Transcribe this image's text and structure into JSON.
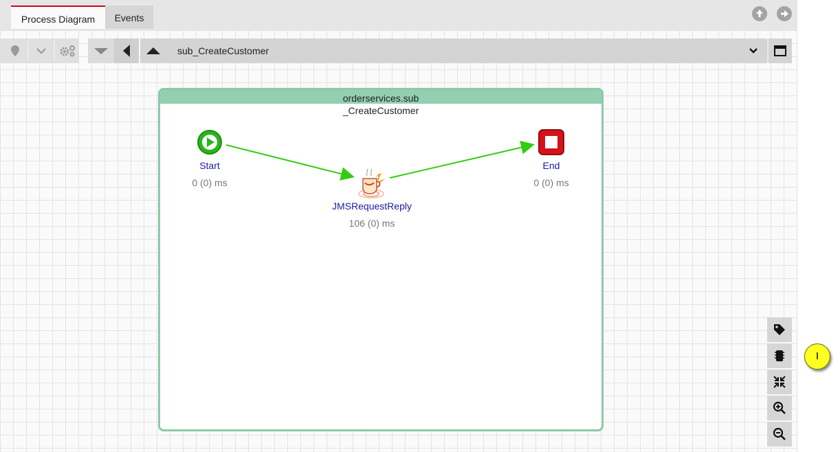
{
  "tabs": [
    {
      "label": "Process Diagram",
      "active": true
    },
    {
      "label": "Events",
      "active": false
    }
  ],
  "nav": {
    "up_icon": "arrow-up-circle-icon",
    "forward_icon": "arrow-right-circle-icon"
  },
  "toolbar": {
    "process_name": "sub_CreateCustomer",
    "icons": [
      "map-pin-icon",
      "chevron-down-icon",
      "gears-icon",
      "triangle-down-icon",
      "triangle-left-icon",
      "triangle-up-icon",
      "dropdown-chevron-icon",
      "maximize-icon"
    ]
  },
  "process": {
    "title_line1": "orderservices.sub",
    "title_line2": "_CreateCustomer",
    "activities": [
      {
        "name": "Start",
        "stat": "0 (0) ms"
      },
      {
        "name": "JMSRequestReply",
        "stat": "106 (0) ms"
      },
      {
        "name": "End",
        "stat": "0 (0) ms"
      }
    ]
  },
  "side_controls": [
    "tag-icon",
    "chip-icon",
    "fit-to-screen-icon",
    "zoom-in-icon",
    "zoom-out-icon"
  ],
  "marker": {
    "label": "I"
  },
  "colors": {
    "tab_accent": "#d0021b",
    "transition": "#33cc11",
    "container": "#8dc8a8",
    "label": "#1a1aa0"
  }
}
